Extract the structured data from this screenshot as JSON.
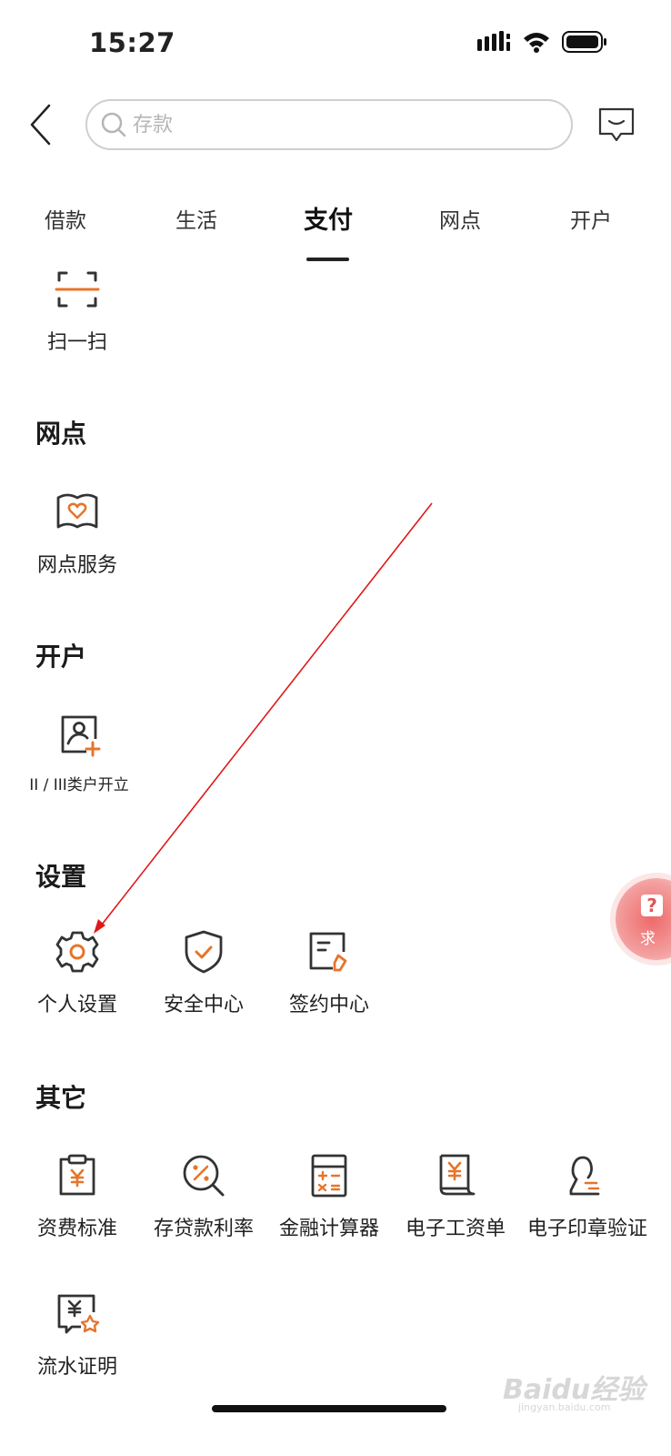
{
  "status_bar": {
    "time": "15:27"
  },
  "search": {
    "placeholder": "存款"
  },
  "tabs": [
    {
      "label": "借款"
    },
    {
      "label": "生活"
    },
    {
      "label": "支付"
    },
    {
      "label": "网点"
    },
    {
      "label": "开户"
    }
  ],
  "active_tab": "支付",
  "pay_items": [
    {
      "label": "扫一扫",
      "icon": "scan-icon"
    }
  ],
  "sections": {
    "outlets": {
      "title": "网点",
      "items": [
        {
          "label": "网点服务",
          "icon": "outlet-service-icon"
        }
      ]
    },
    "account": {
      "title": "开户",
      "items": [
        {
          "label": "II / III类户开立",
          "icon": "open-account-icon"
        }
      ]
    },
    "settings": {
      "title": "设置",
      "items": [
        {
          "label": "个人设置",
          "icon": "gear-icon"
        },
        {
          "label": "安全中心",
          "icon": "shield-icon"
        },
        {
          "label": "签约中心",
          "icon": "contract-icon"
        }
      ]
    },
    "others": {
      "title": "其它",
      "items": [
        {
          "label": "资费标准",
          "icon": "fee-clipboard-icon"
        },
        {
          "label": "存贷款利率",
          "icon": "interest-rate-icon"
        },
        {
          "label": "金融计算器",
          "icon": "calculator-icon"
        },
        {
          "label": "电子工资单",
          "icon": "payslip-icon"
        },
        {
          "label": "电子印章验证",
          "icon": "seal-icon"
        },
        {
          "label": "流水证明",
          "icon": "statement-icon"
        }
      ]
    }
  },
  "help_button": {
    "label": "求"
  },
  "colors": {
    "accent": "#e8742a",
    "icon_dark": "#333333",
    "annotation": "#e01818"
  },
  "watermark": {
    "brand": "Baidu经验",
    "url": "jingyan.baidu.com"
  }
}
